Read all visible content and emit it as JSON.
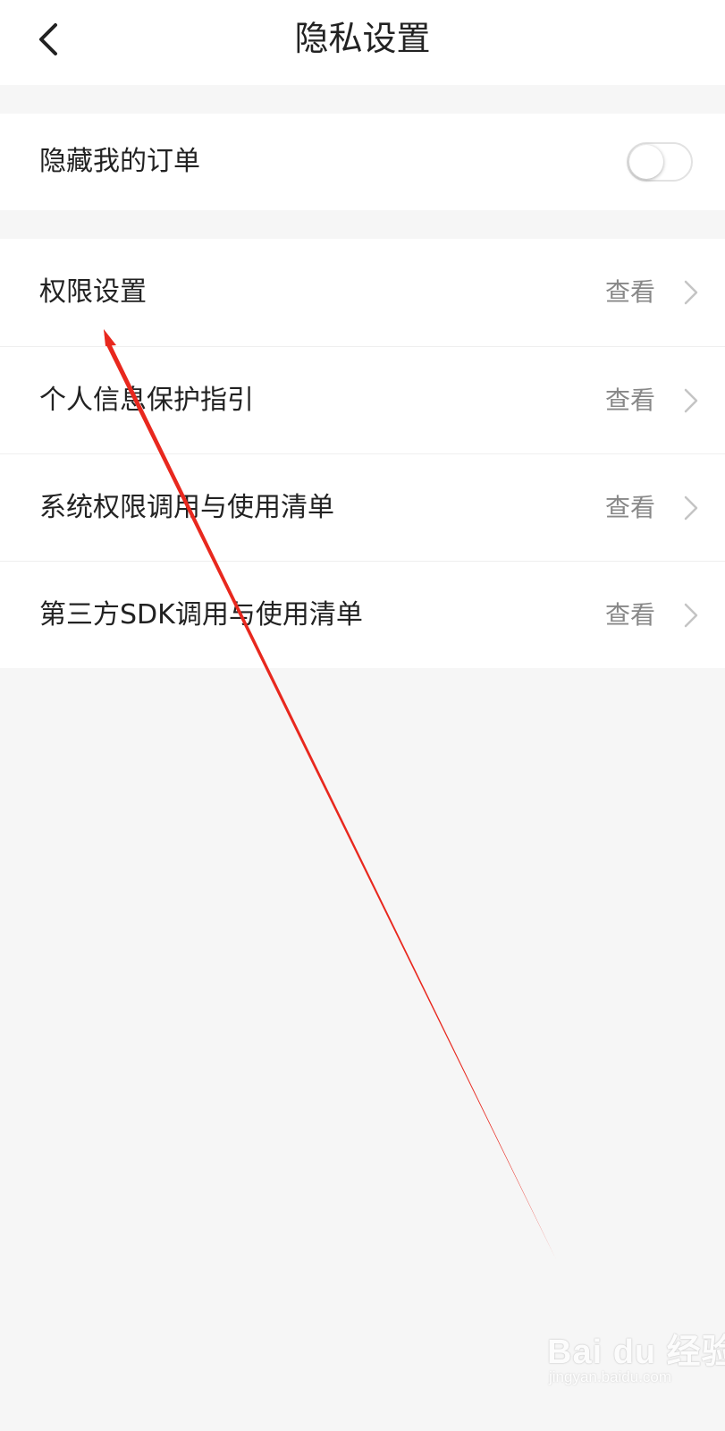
{
  "header": {
    "title": "隐私设置",
    "back_icon": "chevron-left-icon"
  },
  "order_section": {
    "label": "隐藏我的订单",
    "toggle_on": false
  },
  "settings": {
    "view_label": "查看",
    "items": [
      {
        "label": "权限设置"
      },
      {
        "label": "个人信息保护指引"
      },
      {
        "label": "系统权限调用与使用清单"
      },
      {
        "label": "第三方SDK调用与使用清单"
      }
    ]
  },
  "annotation": {
    "arrow_color": "#e8281e"
  },
  "watermark": {
    "brand": "Bai du 经验",
    "url": "jingyan.baidu.com"
  },
  "colors": {
    "background": "#f6f6f6",
    "surface": "#ffffff",
    "secondary_text": "#888888"
  }
}
